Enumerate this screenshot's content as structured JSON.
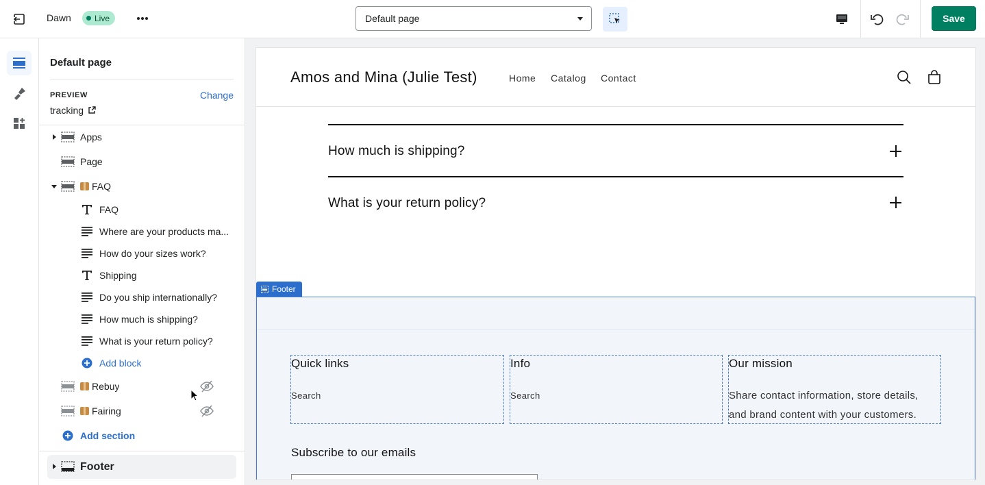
{
  "topbar": {
    "theme_name": "Dawn",
    "live_label": "Live",
    "page_select_value": "Default page",
    "save_label": "Save"
  },
  "sidebar": {
    "title": "Default page",
    "preview_label": "PREVIEW",
    "change_label": "Change",
    "tracking_label": "tracking",
    "sections": {
      "apps": "Apps",
      "page": "Page",
      "faq": "FAQ",
      "faq_blocks": [
        {
          "type": "heading",
          "label": "FAQ"
        },
        {
          "type": "text",
          "label": "Where are your products ma..."
        },
        {
          "type": "text",
          "label": "How do your sizes work?"
        },
        {
          "type": "heading",
          "label": "Shipping"
        },
        {
          "type": "text",
          "label": "Do you ship internationally?"
        },
        {
          "type": "text",
          "label": "How much is shipping?"
        },
        {
          "type": "text",
          "label": "What is your return policy?"
        }
      ],
      "add_block": "Add block",
      "rebuy": "Rebuy",
      "fairing": "Fairing",
      "add_section": "Add section",
      "footer": "Footer"
    }
  },
  "preview": {
    "store_name": "Amos and Mina (Julie Test)",
    "nav": [
      "Home",
      "Catalog",
      "Contact"
    ],
    "faq_questions": [
      "How much is shipping?",
      "What is your return policy?"
    ],
    "footer_tag": "Footer",
    "footer_columns": [
      {
        "title": "Quick links",
        "link": "Search"
      },
      {
        "title": "Info",
        "link": "Search"
      },
      {
        "title": "Our mission",
        "text": "Share contact information, store details, and brand content with your customers."
      }
    ],
    "subscribe_heading": "Subscribe to our emails"
  },
  "colors": {
    "primary_action": "#008060",
    "link_blue": "#2c6ecb",
    "live_badge_bg": "#aee9d1",
    "selection_outline": "#4a7bd0"
  },
  "icons": [
    "exit-icon",
    "more-horizontal-icon",
    "select-inspect-icon",
    "desktop-icon",
    "undo-icon",
    "redo-icon",
    "sections-icon",
    "theme-settings-icon",
    "app-blocks-icon",
    "external-link-icon",
    "heading-block-icon",
    "text-block-icon",
    "add-circle-icon",
    "hidden-eye-icon",
    "search-icon",
    "cart-icon",
    "footer-section-icon"
  ]
}
